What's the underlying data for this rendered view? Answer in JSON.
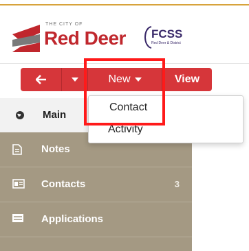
{
  "header": {
    "city_of": "THE CITY OF",
    "city_name": "Red Deer",
    "partner_logo": {
      "name": "FCSS",
      "subtitle": "Red Deer & District"
    }
  },
  "toolbar": {
    "back_icon": "arrow-left-icon",
    "dropdown_icon": "caret-down-icon",
    "new_label": "New",
    "view_label": "View"
  },
  "new_menu": {
    "items": [
      {
        "label": "Contact"
      },
      {
        "label": "Activity"
      }
    ]
  },
  "sidebar": {
    "items": [
      {
        "label": "Main",
        "icon": "globe-icon"
      },
      {
        "label": "Notes",
        "icon": "document-icon"
      },
      {
        "label": "Contacts",
        "icon": "contact-card-icon",
        "count": "3"
      },
      {
        "label": "Applications",
        "icon": "list-icon"
      }
    ]
  },
  "partial_text": "e",
  "colors": {
    "brand_red": "#d6363a",
    "sidebar_tan": "#a49983",
    "highlight": "#ff1a1a",
    "gold_rule": "#d7a33c"
  }
}
